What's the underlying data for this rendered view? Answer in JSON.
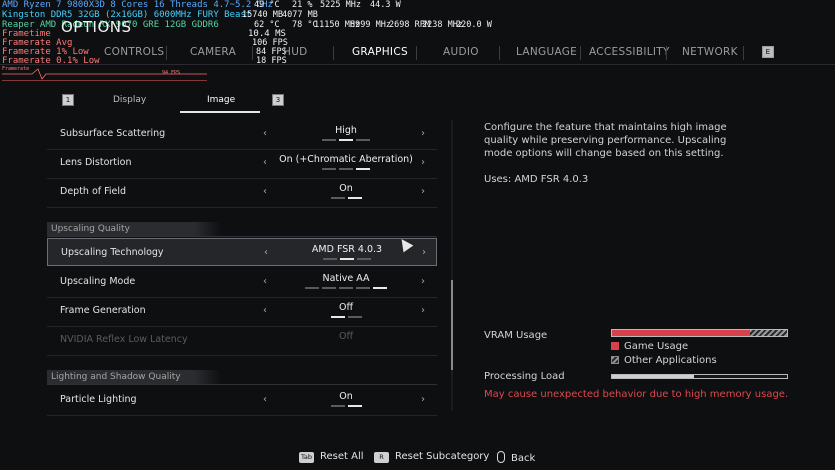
{
  "overlay": {
    "cpu": "AMD Ryzen 7 9800X3D 8 Cores 16 Threads 4.7~5.2 GHz",
    "cpu_temp": "49 °C",
    "cpu_usage": "21 %",
    "cpu_clock": "5225 MHz",
    "cpu_power": "44.3 W",
    "ram": "Kingston DDR5 32GB (2x16GB) 6000MHz FURY Beast",
    "ram_used": "15740 MB",
    "ram_vram": "4077 MB",
    "gpu": "Reaper AMD Radeon RX 9070 GRE 12GB GDDR6",
    "gpu_temp": "62 °C",
    "gpu_hotspot": "78 °C",
    "gpu_clock": "11150 MHz",
    "gpu_mem_clock": "8999 MHz",
    "gpu_fan": "2698 RPM",
    "gpu_core": "2238 MHz",
    "gpu_power": "220.0 W",
    "frametime_label": "Frametime",
    "frametime": "10.4 MS",
    "fps_avg_label": "Framerate Avg",
    "fps_avg": "106 FPS",
    "fps_low1_label": "Framerate 1% Low",
    "fps_low1": "84 FPS",
    "fps_low01_label": "Framerate 0.1% Low",
    "fps_low01": "18 FPS",
    "graph_label": "Framerate",
    "graph_value": "94 FPS"
  },
  "title": "OPTIONS",
  "tabs": [
    {
      "label": "CONTROLS"
    },
    {
      "label": "CAMERA"
    },
    {
      "label": "HUD"
    },
    {
      "label": "GRAPHICS"
    },
    {
      "label": "AUDIO"
    },
    {
      "label": "LANGUAGE"
    },
    {
      "label": "ACCESSIBILITY"
    },
    {
      "label": "NETWORK"
    }
  ],
  "tab_key_right": "E",
  "subtabs": {
    "key_left": "1",
    "display": "Display",
    "image": "Image",
    "key_right": "3"
  },
  "settings": [
    {
      "label": "Subsurface Scattering",
      "value": "High"
    },
    {
      "label": "Lens Distortion",
      "value": "On (+Chromatic Aberration)"
    },
    {
      "label": "Depth of Field",
      "value": "On"
    },
    {
      "section": "Upscaling Quality"
    },
    {
      "label": "Upscaling Technology",
      "value": "AMD FSR 4.0.3"
    },
    {
      "label": "Upscaling Mode",
      "value": "Native AA"
    },
    {
      "label": "Frame Generation",
      "value": "Off"
    },
    {
      "label": "NVIDIA Reflex Low Latency",
      "value": "Off"
    },
    {
      "section": "Lighting and Shadow Quality"
    },
    {
      "label": "Particle Lighting",
      "value": "On"
    }
  ],
  "description": "Configure the feature that maintains high image quality while preserving performance. Upscaling mode options will change based on this setting.",
  "uses": "Uses: AMD FSR 4.0.3",
  "vram": {
    "label": "VRAM Usage",
    "game_fraction": 0.79,
    "other_fraction": 0.21,
    "game_label": "Game Usage",
    "other_label": "Other Applications"
  },
  "processing": {
    "label": "Processing Load",
    "fraction": 0.47
  },
  "warning": "May cause unexpected behavior due to high memory usage.",
  "footer": {
    "reset_all_key": "Tab",
    "reset_all": "Reset All",
    "reset_sub_key": "R",
    "reset_sub": "Reset Subcategory",
    "back": "Back"
  },
  "colors": {
    "accent_red": "#d8404c",
    "warning": "#e0474f"
  }
}
